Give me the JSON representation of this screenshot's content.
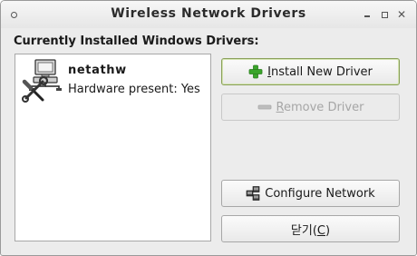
{
  "window": {
    "title": "Wireless Network Drivers"
  },
  "installed": {
    "label": "Currently Installed Windows Drivers:",
    "drivers": [
      {
        "name": "netathw",
        "status": "Hardware present: Yes"
      }
    ]
  },
  "buttons": {
    "install": {
      "first": "I",
      "rest": "nstall New Driver",
      "icon": "green-plus-icon",
      "color": "#3aa52a"
    },
    "remove": {
      "first": "R",
      "rest": "emove Driver",
      "icon": "minus-icon",
      "disabled": true
    },
    "configure": {
      "label": "Configure Network",
      "icon": "network-icon"
    },
    "close": {
      "pre": "닫기(",
      "mnemonic": "C",
      "post": ")"
    }
  }
}
